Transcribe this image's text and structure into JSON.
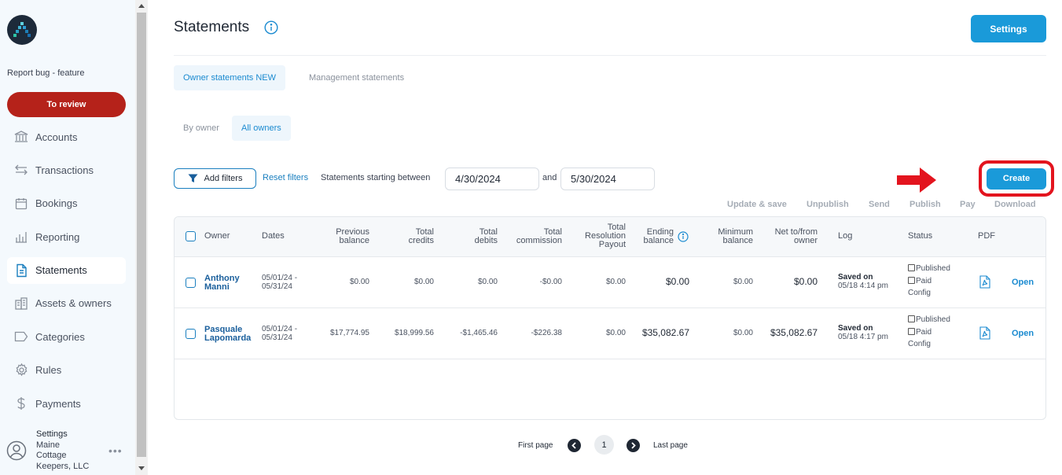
{
  "sidebar": {
    "report_bug": "Report bug - feature",
    "to_review": "To review",
    "items": [
      {
        "label": "Accounts",
        "icon": "bank-icon"
      },
      {
        "label": "Transactions",
        "icon": "transfer-icon"
      },
      {
        "label": "Bookings",
        "icon": "calendar-icon"
      },
      {
        "label": "Reporting",
        "icon": "bar-chart-icon"
      },
      {
        "label": "Statements",
        "icon": "document-icon",
        "active": true
      },
      {
        "label": "Assets & owners",
        "icon": "building-icon"
      },
      {
        "label": "Categories",
        "icon": "tag-icon"
      },
      {
        "label": "Rules",
        "icon": "gear-icon"
      },
      {
        "label": "Payments",
        "icon": "dollar-icon"
      }
    ],
    "user": {
      "settings": "Settings",
      "line1": "Maine",
      "line2": "Cottage",
      "line3": "Keepers, LLC",
      "more": "•••"
    }
  },
  "header": {
    "title": "Statements",
    "settings_button": "Settings"
  },
  "tabs": {
    "owner_statements": "Owner statements NEW",
    "management_statements": "Management statements"
  },
  "subtabs": {
    "by_owner": "By owner",
    "all_owners": "All owners"
  },
  "filters": {
    "add_filters": "Add filters",
    "reset_filters": "Reset filters",
    "statements_between": "Statements starting between",
    "start_date": "4/30/2024",
    "and": "and",
    "end_date": "5/30/2024"
  },
  "create_button": "Create",
  "actions": {
    "update_save": "Update & save",
    "unpublish": "Unpublish",
    "send": "Send",
    "publish": "Publish",
    "pay": "Pay",
    "download": "Download"
  },
  "table": {
    "headers": {
      "owner": "Owner",
      "dates": "Dates",
      "previous_balance_1": "Previous",
      "previous_balance_2": "balance",
      "total_credits_1": "Total",
      "total_credits_2": "credits",
      "total_debits_1": "Total",
      "total_debits_2": "debits",
      "total_commission_1": "Total",
      "total_commission_2": "commission",
      "resolution_1": "Total",
      "resolution_2": "Resolution",
      "resolution_3": "Payout",
      "ending_balance_1": "Ending",
      "ending_balance_2": "balance",
      "minimum_balance_1": "Minimum",
      "minimum_balance_2": "balance",
      "net_1": "Net to/from",
      "net_2": "owner",
      "log": "Log",
      "status": "Status",
      "pdf": "PDF"
    },
    "rows": [
      {
        "owner_1": "Anthony",
        "owner_2": "Manni",
        "dates_1": "05/01/24 -",
        "dates_2": "05/31/24",
        "previous_balance": "$0.00",
        "total_credits": "$0.00",
        "total_debits": "$0.00",
        "total_commission": "-$0.00",
        "resolution_payout": "$0.00",
        "ending_balance": "$0.00",
        "minimum_balance": "$0.00",
        "net": "$0.00",
        "log_1": "Saved on",
        "log_2": "05/18 4:14 pm",
        "status_published": "Published",
        "status_paid": "Paid",
        "status_config": "Config",
        "open": "Open"
      },
      {
        "owner_1": "Pasquale",
        "owner_2": "Lapomarda",
        "dates_1": "05/01/24 -",
        "dates_2": "05/31/24",
        "previous_balance": "$17,774.95",
        "total_credits": "$18,999.56",
        "total_debits": "-$1,465.46",
        "total_commission": "-$226.38",
        "resolution_payout": "$0.00",
        "ending_balance": "$35,082.67",
        "minimum_balance": "$0.00",
        "net": "$35,082.67",
        "log_1": "Saved on",
        "log_2": "05/18 4:17 pm",
        "status_published": "Published",
        "status_paid": "Paid",
        "status_config": "Config",
        "open": "Open"
      }
    ]
  },
  "pagination": {
    "first_page": "First page",
    "current_page": "1",
    "last_page": "Last page"
  },
  "colors": {
    "primary": "#1a9ad9",
    "to_review": "#b5221a",
    "highlight_red": "#e3141e",
    "sidebar_bg": "#f4f9fd"
  }
}
